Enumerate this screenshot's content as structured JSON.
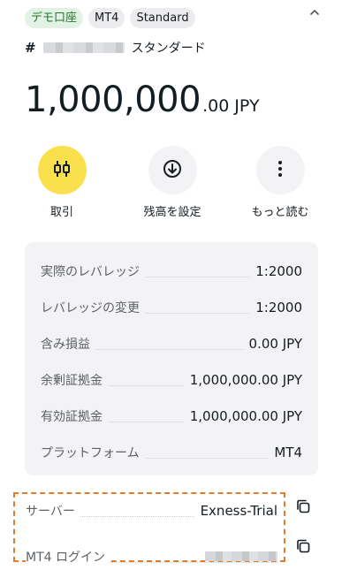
{
  "badges": {
    "account_type": "デモ口座",
    "platform": "MT4",
    "plan": "Standard"
  },
  "account": {
    "hash": "#",
    "name": "スタンダード"
  },
  "balance": {
    "main": "1,000,000",
    "decimals": ".00",
    "currency": "JPY"
  },
  "actions": {
    "trade": "取引",
    "set_balance": "残高を設定",
    "more": "もっと読む"
  },
  "details": [
    {
      "label": "実際のレバレッジ",
      "value": "1:2000"
    },
    {
      "label": "レバレッジの変更",
      "value": "1:2000"
    },
    {
      "label": "含み損益",
      "value": "0.00 JPY"
    },
    {
      "label": "余剰証拠金",
      "value": "1,000,000.00 JPY"
    },
    {
      "label": "有効証拠金",
      "value": "1,000,000.00 JPY"
    },
    {
      "label": "プラットフォーム",
      "value": "MT4"
    }
  ],
  "server": {
    "server_label": "サーバー",
    "server_value": "Exness-Trial",
    "login_label": "MT4 ログイン"
  },
  "colors": {
    "demo_badge_bg": "#e3f2e4",
    "demo_badge_text": "#1f7a2c",
    "trade_button": "#fbe04d",
    "highlight_border": "#e07c2c",
    "panel_bg": "#f3f3f5"
  },
  "icons": {
    "collapse": "chevron-up-icon",
    "trade": "candlestick-icon",
    "set_balance": "arrow-down-circle-icon",
    "more": "more-vertical-icon",
    "copy": "copy-icon"
  }
}
